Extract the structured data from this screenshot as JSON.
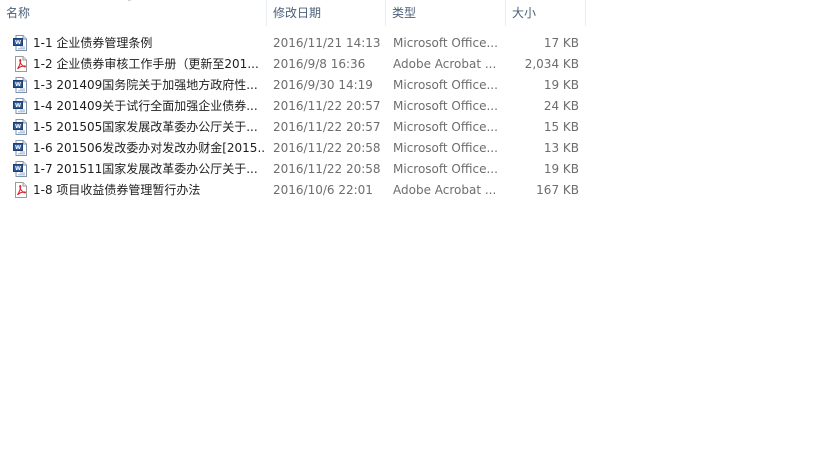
{
  "columns": {
    "name": "名称",
    "date": "修改日期",
    "type": "类型",
    "size": "大小"
  },
  "sort_indicator": "˄",
  "files": [
    {
      "icon": "word-doc-icon",
      "name": "1-1 企业债券管理条例",
      "date": "2016/11/21 14:13",
      "type": "Microsoft Office...",
      "size": "17 KB"
    },
    {
      "icon": "pdf-icon",
      "name": "1-2 企业债券审核工作手册（更新至201...",
      "date": "2016/9/8 16:36",
      "type": "Adobe Acrobat ...",
      "size": "2,034 KB"
    },
    {
      "icon": "word-doc-icon",
      "name": "1-3 201409国务院关于加强地方政府性...",
      "date": "2016/9/30 14:19",
      "type": "Microsoft Office...",
      "size": "19 KB"
    },
    {
      "icon": "word-doc-icon",
      "name": "1-4 201409关于试行全面加强企业债券...",
      "date": "2016/11/22 20:57",
      "type": "Microsoft Office...",
      "size": "24 KB"
    },
    {
      "icon": "word-doc-icon",
      "name": "1-5 201505国家发展改革委办公厅关于...",
      "date": "2016/11/22 20:57",
      "type": "Microsoft Office...",
      "size": "15 KB"
    },
    {
      "icon": "word-doc-icon",
      "name": "1-6 201506发改委办对发改办财金[2015...",
      "date": "2016/11/22 20:58",
      "type": "Microsoft Office...",
      "size": "13 KB"
    },
    {
      "icon": "word-doc-icon",
      "name": "1-7 201511国家发展改革委办公厅关于...",
      "date": "2016/11/22 20:58",
      "type": "Microsoft Office...",
      "size": "19 KB"
    },
    {
      "icon": "pdf-icon",
      "name": "1-8 项目收益债券管理暂行办法",
      "date": "2016/10/6 22:01",
      "type": "Adobe Acrobat ...",
      "size": "167 KB"
    }
  ]
}
